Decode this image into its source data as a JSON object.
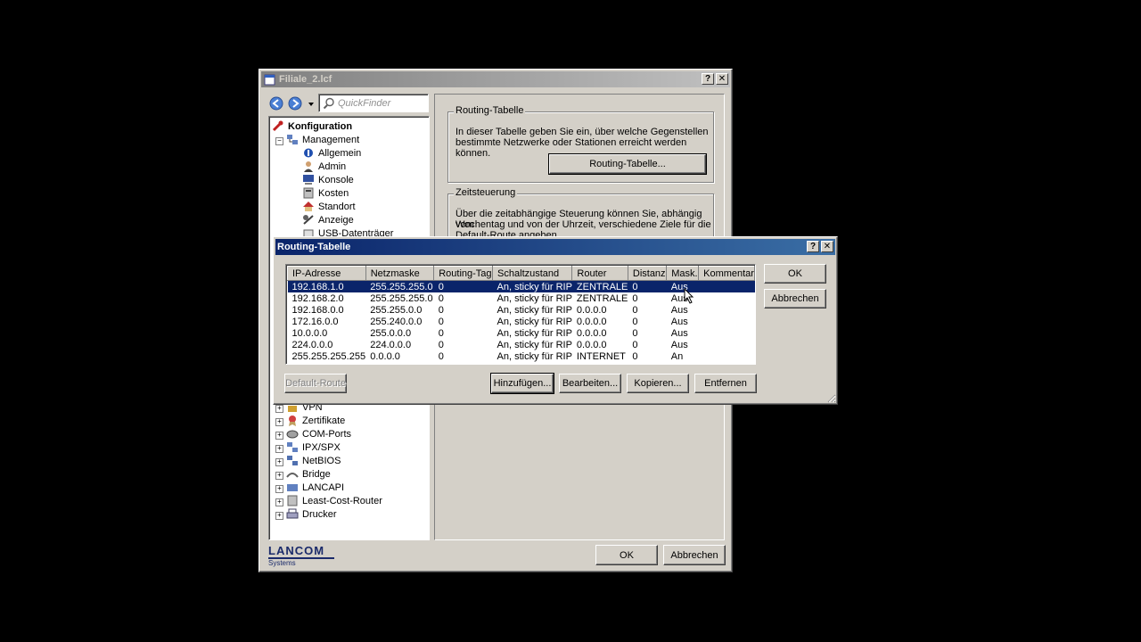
{
  "main_window": {
    "title": "Filiale_2.lcf",
    "help_glyph": "?",
    "close_glyph": "✕",
    "quickfinder_placeholder": "QuickFinder",
    "tree": [
      {
        "label": "Konfiguration",
        "icon": "wrench-icon",
        "bold": true
      },
      {
        "label": "Management",
        "icon": "network-icon",
        "bold": false
      },
      {
        "label": "Allgemein",
        "icon": "general-icon",
        "bold": false
      },
      {
        "label": "Admin",
        "icon": "admin-user-icon",
        "bold": false
      },
      {
        "label": "Konsole",
        "icon": "console-icon",
        "bold": false
      },
      {
        "label": "Kosten",
        "icon": "cost-icon",
        "bold": false
      },
      {
        "label": "Standort",
        "icon": "house-icon",
        "bold": false
      },
      {
        "label": "Anzeige",
        "icon": "display-icon",
        "bold": false
      },
      {
        "label": "USB-Datenträger",
        "icon": "usb-icon",
        "bold": false
      }
    ],
    "tree_lower": [
      {
        "label": "VPN",
        "icon": "vpn-icon"
      },
      {
        "label": "Zertifikate",
        "icon": "certificate-icon"
      },
      {
        "label": "COM-Ports",
        "icon": "com-port-icon"
      },
      {
        "label": "IPX/SPX",
        "icon": "ipx-icon"
      },
      {
        "label": "NetBIOS",
        "icon": "netbios-icon"
      },
      {
        "label": "Bridge",
        "icon": "bridge-icon"
      },
      {
        "label": "LANCAPI",
        "icon": "lancapi-icon"
      },
      {
        "label": "Least-Cost-Router",
        "icon": "router-icon"
      },
      {
        "label": "Drucker",
        "icon": "printer-icon"
      }
    ],
    "routing_group": {
      "label": "Routing-Tabelle",
      "desc_line1": "In dieser Tabelle geben Sie ein, über welche Gegenstellen",
      "desc_line2": "bestimmte Netzwerke oder Stationen erreicht werden können.",
      "button": "Routing-Tabelle..."
    },
    "time_group": {
      "label": "Zeitsteuerung",
      "desc_line1": "Über die zeitabhängige Steuerung können Sie, abhängig vom",
      "desc_line2": "Wochentag und von der Uhrzeit, verschiedene Ziele für die",
      "desc_line3": "Default-Route angeben."
    },
    "logo_text": "LANCOM",
    "logo_sub": "Systems",
    "ok": "OK",
    "cancel": "Abbrechen"
  },
  "dialog": {
    "title": "Routing-Tabelle",
    "help_glyph": "?",
    "close_glyph": "✕",
    "columns": [
      "IP-Adresse",
      "Netzmaske",
      "Routing-Tag",
      "Schaltzustand",
      "Router",
      "Distanz",
      "Mask.",
      "Kommentar"
    ],
    "rows": [
      {
        "ip": "192.168.1.0",
        "mask": "255.255.255.0",
        "tag": "0",
        "state": "An, sticky für RIP",
        "router": "ZENTRALE",
        "dist": "0",
        "masq": "Aus",
        "comment": ""
      },
      {
        "ip": "192.168.2.0",
        "mask": "255.255.255.0",
        "tag": "0",
        "state": "An, sticky für RIP",
        "router": "ZENTRALE",
        "dist": "0",
        "masq": "Aus",
        "comment": ""
      },
      {
        "ip": "192.168.0.0",
        "mask": "255.255.0.0",
        "tag": "0",
        "state": "An, sticky für RIP",
        "router": "0.0.0.0",
        "dist": "0",
        "masq": "Aus",
        "comment": ""
      },
      {
        "ip": "172.16.0.0",
        "mask": "255.240.0.0",
        "tag": "0",
        "state": "An, sticky für RIP",
        "router": "0.0.0.0",
        "dist": "0",
        "masq": "Aus",
        "comment": ""
      },
      {
        "ip": "10.0.0.0",
        "mask": "255.0.0.0",
        "tag": "0",
        "state": "An, sticky für RIP",
        "router": "0.0.0.0",
        "dist": "0",
        "masq": "Aus",
        "comment": ""
      },
      {
        "ip": "224.0.0.0",
        "mask": "224.0.0.0",
        "tag": "0",
        "state": "An, sticky für RIP",
        "router": "0.0.0.0",
        "dist": "0",
        "masq": "Aus",
        "comment": ""
      },
      {
        "ip": "255.255.255.255",
        "mask": "0.0.0.0",
        "tag": "0",
        "state": "An, sticky für RIP",
        "router": "INTERNET",
        "dist": "0",
        "masq": "An",
        "comment": ""
      }
    ],
    "selected_row": 0,
    "ok": "OK",
    "cancel": "Abbrechen",
    "default_route": "Default-Route",
    "add": "Hinzufügen...",
    "edit": "Bearbeiten...",
    "copy": "Kopieren...",
    "remove": "Entfernen"
  },
  "colors": {
    "active_title": "#0a246a",
    "inactive_title": "#808080",
    "selection": "#0a246a"
  }
}
